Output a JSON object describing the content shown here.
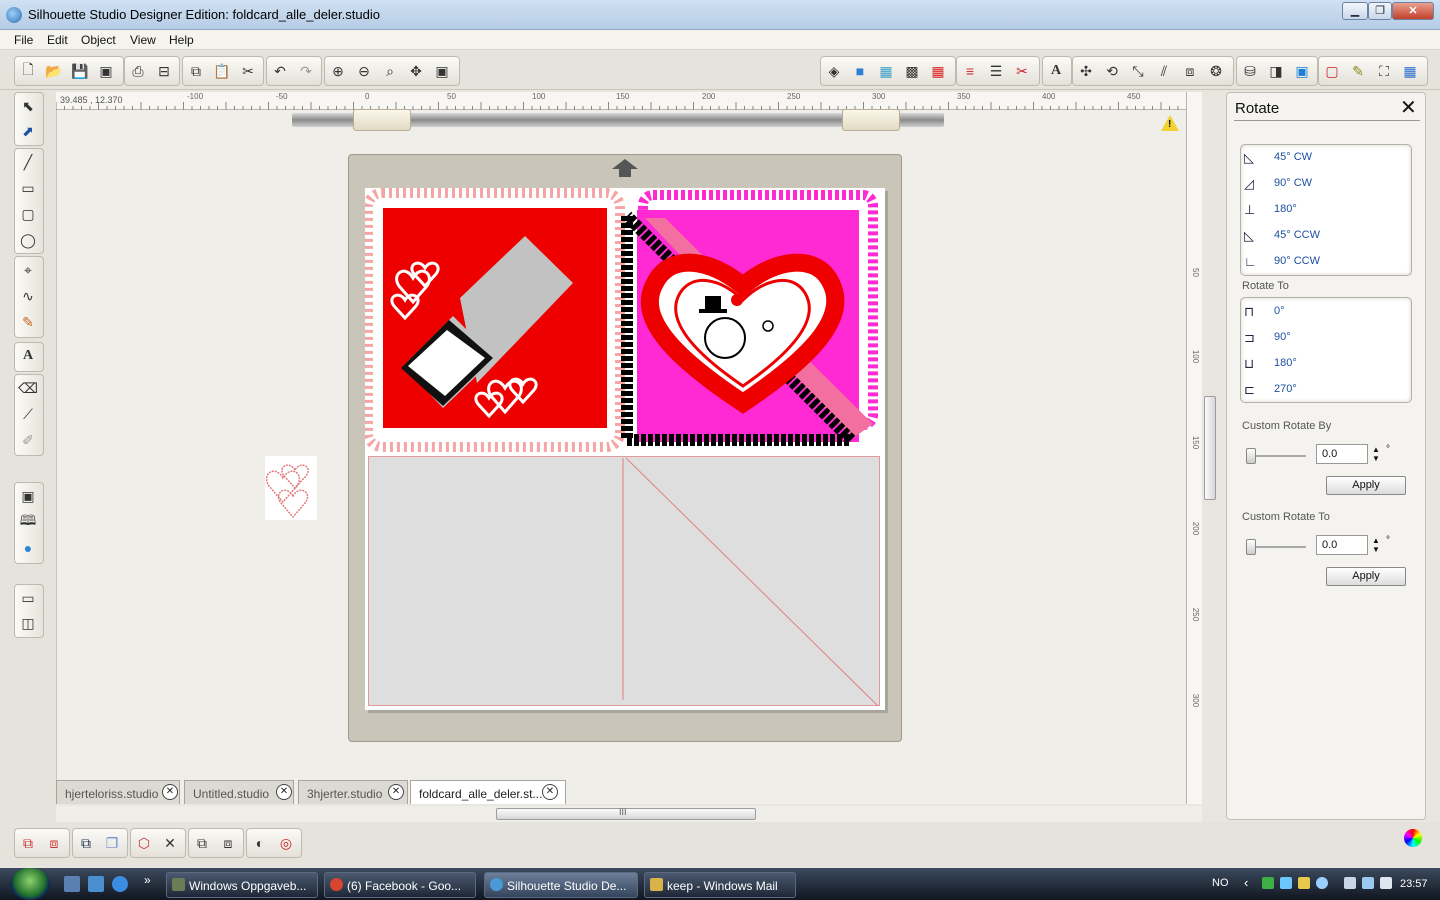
{
  "window": {
    "title": "Silhouette Studio Designer Edition: foldcard_alle_deler.studio",
    "controls": [
      "▁",
      "❐",
      "✕"
    ]
  },
  "menu": [
    "File",
    "Edit",
    "Object",
    "View",
    "Help"
  ],
  "canvas": {
    "coordinates": "39.485 , 12.370",
    "ruler_h_labels": [
      "-100",
      "-50",
      "0",
      "50",
      "100",
      "150",
      "200",
      "250",
      "300",
      "350",
      "400",
      "450",
      "50"
    ],
    "ruler_v_labels": [
      "50",
      "100",
      "150",
      "200",
      "250",
      "300"
    ],
    "warning": "!"
  },
  "tabs": [
    {
      "label": "hjerteloriss.studio"
    },
    {
      "label": "Untitled.studio"
    },
    {
      "label": "3hjerter.studio"
    },
    {
      "label": "foldcard_alle_deler.st..."
    }
  ],
  "scroll_grip": "III",
  "rotate_panel": {
    "title": "Rotate",
    "rotate_by": [
      "45° CW",
      "90° CW",
      "180°",
      "45° CCW",
      "90° CCW"
    ],
    "rotate_to_label": "Rotate To",
    "rotate_to": [
      "0°",
      "90°",
      "180°",
      "270°"
    ],
    "custom_by_label": "Custom Rotate By",
    "custom_by_value": "0.0",
    "custom_to_label": "Custom Rotate To",
    "custom_to_value": "0.0",
    "degree_symbol": "°",
    "apply_label": "Apply"
  },
  "taskbar": {
    "items": [
      {
        "label": "Windows Oppgaveb...",
        "color": "#6a7d55"
      },
      {
        "label": "(6) Facebook - Goo...",
        "color": "#d8452f"
      },
      {
        "label": "Silhouette Studio De...",
        "color": "#4a9ad8"
      },
      {
        "label": "keep - Windows Mail",
        "color": "#d9b24a"
      }
    ],
    "overflow": "»",
    "language": "NO",
    "tray_arrow": "‹",
    "time": "23:57"
  },
  "colors": {
    "red_card": "#ee0000",
    "pink_card": "#ff2ad4",
    "lace_pink": "#f6a5a5",
    "accent_blue": "#1e4fa0"
  }
}
